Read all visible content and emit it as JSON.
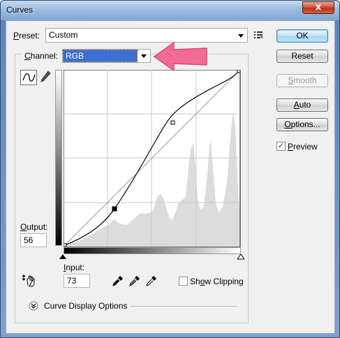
{
  "window": {
    "title": "Curves",
    "close_glyph": "x"
  },
  "preset": {
    "label": "Preset:",
    "value": "Custom",
    "menu_icon": "preset-options-icon"
  },
  "channel": {
    "label": "Channel:",
    "value": "RGB"
  },
  "buttons": {
    "ok": "OK",
    "reset": "Reset",
    "smooth": "Smooth",
    "auto": "Auto",
    "options": "Options..."
  },
  "preview": {
    "label": "Preview",
    "checked": true
  },
  "output": {
    "label": "Output:",
    "value": "56"
  },
  "input": {
    "label": "Input:",
    "value": "73"
  },
  "show_clipping": {
    "label": "Show Clipping",
    "checked": false
  },
  "curve_display": {
    "label": "Curve Display Options"
  },
  "colors": {
    "arrow": "#f36b95",
    "selection": "#3c6fd1"
  }
}
